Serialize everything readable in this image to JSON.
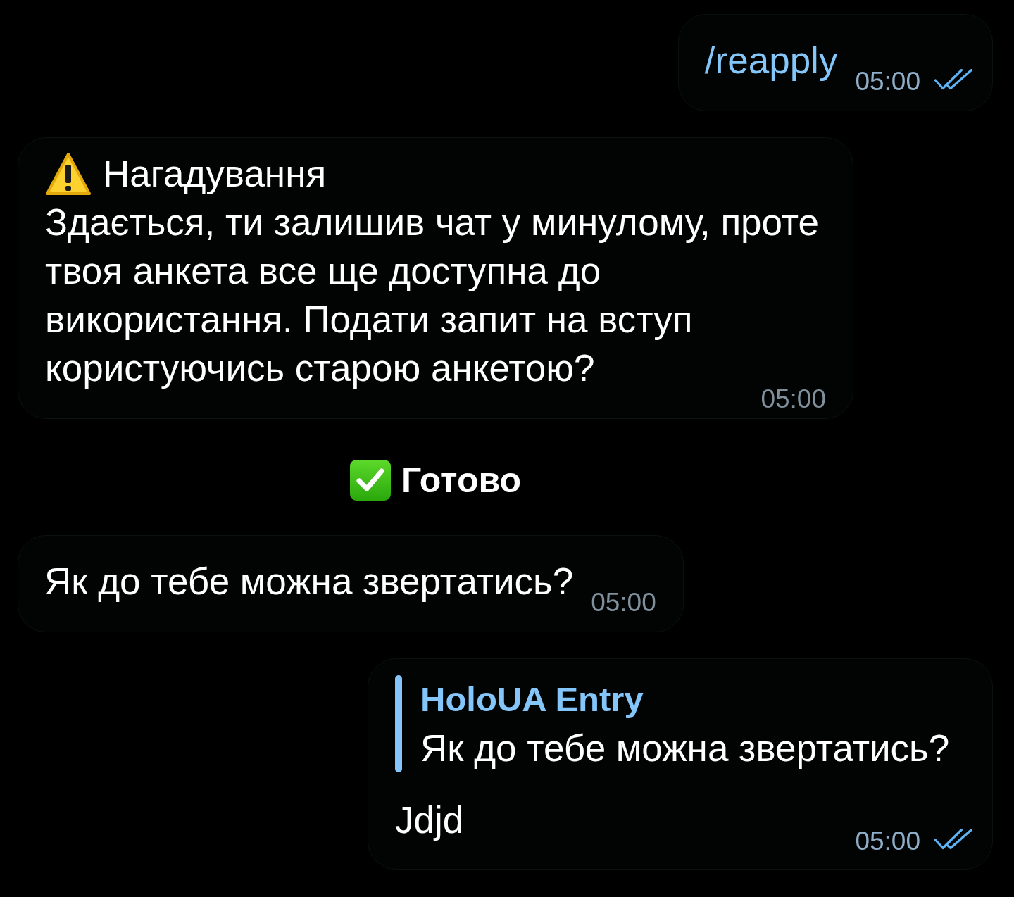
{
  "chat": {
    "messages": [
      {
        "kind": "bubble",
        "outgoing": true,
        "text": "/reapply",
        "command": true,
        "time": "05:00",
        "read": true
      },
      {
        "kind": "bubble",
        "outgoing": false,
        "title": "Нагадування",
        "text": "Здається, ти залишив чат у минулому, проте твоя анкета все ще доступна до використання. Подати запит на вступ користуючись старою анкетою?",
        "command": false,
        "time": "05:00"
      },
      {
        "kind": "notice",
        "text": "Готово"
      },
      {
        "kind": "bubble",
        "outgoing": false,
        "text": "Як до тебе можна звертатись?",
        "command": false,
        "time": "05:00"
      },
      {
        "kind": "bubble",
        "outgoing": true,
        "reply_to": {
          "author": "HoloUA Entry",
          "text": "Як до тебе можна звертатись?"
        },
        "text": "Jdjd",
        "command": false,
        "time": "05:00",
        "read": true
      }
    ]
  }
}
